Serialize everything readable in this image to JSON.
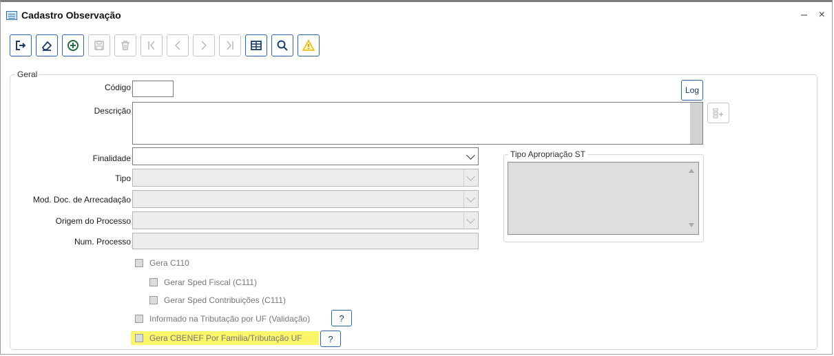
{
  "window": {
    "title": "Cadastro Observação",
    "minimize_glyph": "–",
    "close_glyph": "×"
  },
  "toolbar": [
    {
      "name": "exit-button",
      "icon": "exit-icon",
      "enabled": true
    },
    {
      "name": "clear-button",
      "icon": "eraser-icon",
      "enabled": true
    },
    {
      "name": "new-button",
      "icon": "plus-circle-icon",
      "enabled": true
    },
    {
      "name": "save-button",
      "icon": "save-icon",
      "enabled": false
    },
    {
      "name": "delete-button",
      "icon": "trash-icon",
      "enabled": false
    },
    {
      "name": "first-record-button",
      "icon": "first-icon",
      "enabled": false
    },
    {
      "name": "previous-record-button",
      "icon": "previous-icon",
      "enabled": false
    },
    {
      "name": "next-record-button",
      "icon": "next-icon",
      "enabled": false
    },
    {
      "name": "last-record-button",
      "icon": "last-icon",
      "enabled": false
    },
    {
      "name": "grid-button",
      "icon": "table-icon",
      "enabled": true
    },
    {
      "name": "search-button",
      "icon": "search-icon",
      "enabled": true
    },
    {
      "name": "warning-button",
      "icon": "warning-icon",
      "enabled": true
    }
  ],
  "form": {
    "group_label": "Geral",
    "codigo_label": "Código",
    "codigo_value": "",
    "log_button": "Log",
    "descricao_label": "Descrição",
    "descricao_value": "",
    "finalidade_label": "Finalidade",
    "finalidade_value": "",
    "tipo_label": "Tipo",
    "tipo_value": "",
    "mod_doc_label": "Mod. Doc. de Arrecadação",
    "mod_doc_value": "",
    "origem_label": "Origem do Processo",
    "origem_value": "",
    "num_processo_label": "Num. Processo",
    "num_processo_value": "",
    "tipo_apropriacao_label": "Tipo Apropriação ST"
  },
  "checkboxes": {
    "gera_c110": "Gera C110",
    "sped_fiscal": "Gerar Sped Fiscal (C111)",
    "sped_contrib": "Gerar Sped Contribuições (C111)",
    "informado_uf": "Informado na Tributação por UF (Validação)",
    "gera_cbenef": "Gera CBENEF Por Familia/Tributação UF",
    "help_label": "?"
  },
  "colors": {
    "accent": "#2e64a8",
    "highlight": "#fbf56a",
    "warning": "#e8b800"
  }
}
